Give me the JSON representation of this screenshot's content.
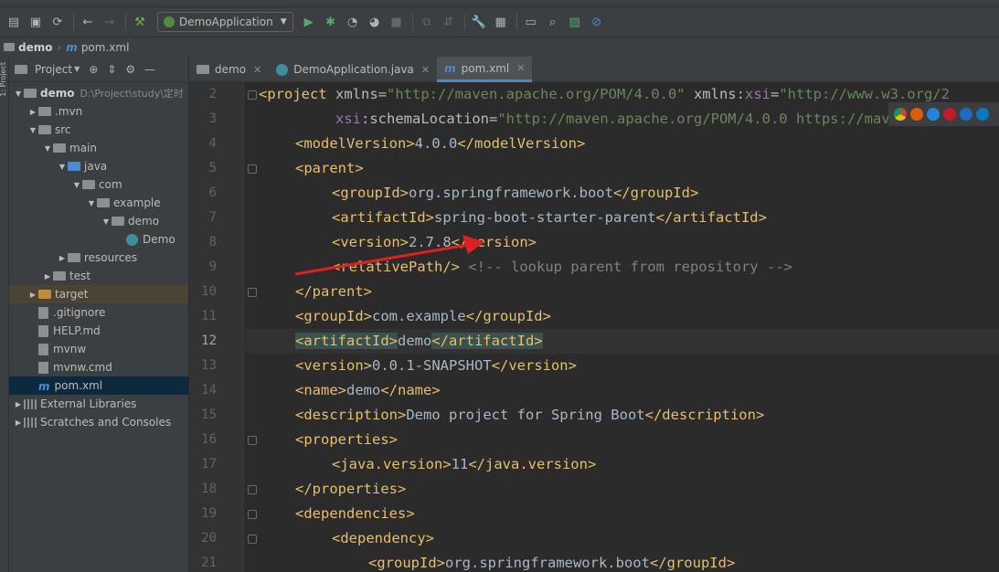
{
  "toolbar": {
    "run_config": "DemoApplication",
    "icons": [
      "save-icon",
      "sync-icon",
      "back-icon",
      "forward-icon",
      "build-icon",
      "run-icon",
      "debug-icon",
      "coverage-icon",
      "profile-icon",
      "stop-icon",
      "attach-icon",
      "settings-icon",
      "project-structure-icon",
      "layout-icon",
      "search-icon",
      "vcs-icon",
      "blocked-icon"
    ]
  },
  "breadcrumb": {
    "project": "demo",
    "file": "pom.xml",
    "m_glyph": "m"
  },
  "left_strip": {
    "label": "1: Project"
  },
  "project_panel": {
    "title": "Project",
    "tree": [
      {
        "label": "demo",
        "path": "D:\\Project\\study\\定时",
        "level": 0,
        "expanded": true,
        "kind": "folder",
        "bold": true
      },
      {
        "label": ".mvn",
        "level": 1,
        "expanded": false,
        "kind": "folder"
      },
      {
        "label": "src",
        "level": 1,
        "expanded": true,
        "kind": "folder"
      },
      {
        "label": "main",
        "level": 2,
        "expanded": true,
        "kind": "folder"
      },
      {
        "label": "java",
        "level": 3,
        "expanded": true,
        "kind": "folder-blue"
      },
      {
        "label": "com",
        "level": 4,
        "expanded": true,
        "kind": "folder"
      },
      {
        "label": "example",
        "level": 5,
        "expanded": true,
        "kind": "folder"
      },
      {
        "label": "demo",
        "level": 6,
        "expanded": true,
        "kind": "folder"
      },
      {
        "label": "Demo",
        "level": 7,
        "kind": "class"
      },
      {
        "label": "resources",
        "level": 3,
        "expanded": false,
        "kind": "folder-res"
      },
      {
        "label": "test",
        "level": 2,
        "expanded": false,
        "kind": "folder"
      },
      {
        "label": "target",
        "level": 1,
        "expanded": false,
        "kind": "folder-orange",
        "excluded": true
      },
      {
        "label": ".gitignore",
        "level": 1,
        "kind": "file"
      },
      {
        "label": "HELP.md",
        "level": 1,
        "kind": "file"
      },
      {
        "label": "mvnw",
        "level": 1,
        "kind": "file"
      },
      {
        "label": "mvnw.cmd",
        "level": 1,
        "kind": "file"
      },
      {
        "label": "pom.xml",
        "level": 1,
        "kind": "mfile",
        "selected": true
      },
      {
        "label": "External Libraries",
        "level": 0,
        "expanded": false,
        "kind": "lib"
      },
      {
        "label": "Scratches and Consoles",
        "level": 0,
        "expanded": false,
        "kind": "lib"
      }
    ]
  },
  "tabs": [
    {
      "label": "demo",
      "kind": "folder",
      "active": false
    },
    {
      "label": "DemoApplication.java",
      "kind": "class",
      "active": false
    },
    {
      "label": "pom.xml",
      "kind": "mfile",
      "active": true
    }
  ],
  "editor": {
    "current_line": 12,
    "lines": [
      {
        "n": "2",
        "fold": true,
        "indent": 0,
        "tokens": [
          [
            "t",
            "<project "
          ],
          [
            "a",
            "xmlns"
          ],
          [
            "tx",
            "="
          ],
          [
            "v",
            "\"http://maven.apache.org/POM/4.0.0\""
          ],
          [
            "a",
            " xmlns"
          ],
          [
            "tx",
            ":"
          ],
          [
            "ns",
            "xsi"
          ],
          [
            "tx",
            "="
          ],
          [
            "v",
            "\"http://www.w3.org/2"
          ]
        ]
      },
      {
        "n": "3",
        "indent": 0,
        "tokens": [
          [
            "a",
            "         "
          ],
          [
            "ns",
            "xsi"
          ],
          [
            "tx",
            ":"
          ],
          [
            "a",
            "schemaLocation"
          ],
          [
            "tx",
            "="
          ],
          [
            "v",
            "\"http://maven.apache.org/POM/4.0.0 https://maven.apa"
          ]
        ]
      },
      {
        "n": "4",
        "indent": 1,
        "tokens": [
          [
            "t",
            "<modelVersion>"
          ],
          [
            "tx",
            "4.0.0"
          ],
          [
            "t",
            "</modelVersion>"
          ]
        ]
      },
      {
        "n": "5",
        "fold": true,
        "indent": 1,
        "tokens": [
          [
            "t",
            "<parent>"
          ]
        ]
      },
      {
        "n": "6",
        "indent": 2,
        "tokens": [
          [
            "t",
            "<groupId>"
          ],
          [
            "tx",
            "org.springframework.boot"
          ],
          [
            "t",
            "</groupId>"
          ]
        ]
      },
      {
        "n": "7",
        "indent": 2,
        "tokens": [
          [
            "t",
            "<artifactId>"
          ],
          [
            "tx",
            "spring-boot-starter-parent"
          ],
          [
            "t",
            "</artifactId>"
          ]
        ]
      },
      {
        "n": "8",
        "indent": 2,
        "tokens": [
          [
            "t",
            "<version>"
          ],
          [
            "tx",
            "2.7.8"
          ],
          [
            "t",
            "</version>"
          ]
        ]
      },
      {
        "n": "9",
        "indent": 2,
        "tokens": [
          [
            "t",
            "<relativePath/>"
          ],
          [
            "tx",
            " "
          ],
          [
            "cm",
            "<!-- lookup parent from repository -->"
          ]
        ]
      },
      {
        "n": "10",
        "fold": true,
        "indent": 1,
        "tokens": [
          [
            "t",
            "</parent>"
          ]
        ]
      },
      {
        "n": "11",
        "indent": 1,
        "tokens": [
          [
            "t",
            "<groupId>"
          ],
          [
            "tx",
            "com.example"
          ],
          [
            "t",
            "</groupId>"
          ]
        ]
      },
      {
        "n": "12",
        "indent": 1,
        "tokens": [
          [
            "t hl",
            "<artifactId>"
          ],
          [
            "tx",
            "demo"
          ],
          [
            "t hl",
            "</artifactId>"
          ]
        ]
      },
      {
        "n": "13",
        "indent": 1,
        "tokens": [
          [
            "t",
            "<version>"
          ],
          [
            "tx",
            "0.0.1-SNAPSHOT"
          ],
          [
            "t",
            "</version>"
          ]
        ]
      },
      {
        "n": "14",
        "indent": 1,
        "tokens": [
          [
            "t",
            "<name>"
          ],
          [
            "tx",
            "demo"
          ],
          [
            "t",
            "</name>"
          ]
        ]
      },
      {
        "n": "15",
        "indent": 1,
        "tokens": [
          [
            "t",
            "<description>"
          ],
          [
            "tx",
            "Demo project for Spring Boot"
          ],
          [
            "t",
            "</description>"
          ]
        ]
      },
      {
        "n": "16",
        "fold": true,
        "indent": 1,
        "tokens": [
          [
            "t",
            "<properties>"
          ]
        ]
      },
      {
        "n": "17",
        "indent": 2,
        "tokens": [
          [
            "t",
            "<java.version>"
          ],
          [
            "tx",
            "11"
          ],
          [
            "t",
            "</java.version>"
          ]
        ]
      },
      {
        "n": "18",
        "fold": true,
        "indent": 1,
        "tokens": [
          [
            "t",
            "</properties>"
          ]
        ]
      },
      {
        "n": "19",
        "fold": true,
        "indent": 1,
        "tokens": [
          [
            "t",
            "<dependencies>"
          ]
        ]
      },
      {
        "n": "20",
        "fold": true,
        "indent": 2,
        "tokens": [
          [
            "t",
            "<dependency>"
          ]
        ]
      },
      {
        "n": "21",
        "indent": 3,
        "tokens": [
          [
            "t",
            "<groupId>"
          ],
          [
            "tx",
            "org.springframework.boot"
          ],
          [
            "t",
            "</groupId>"
          ]
        ]
      }
    ]
  },
  "colors": {
    "tag": "#e8bf6a",
    "string": "#6a8759",
    "text": "#a9b7c6",
    "comment": "#808080",
    "namespace": "#9876aa",
    "annotation_arrow": "#e02020"
  }
}
